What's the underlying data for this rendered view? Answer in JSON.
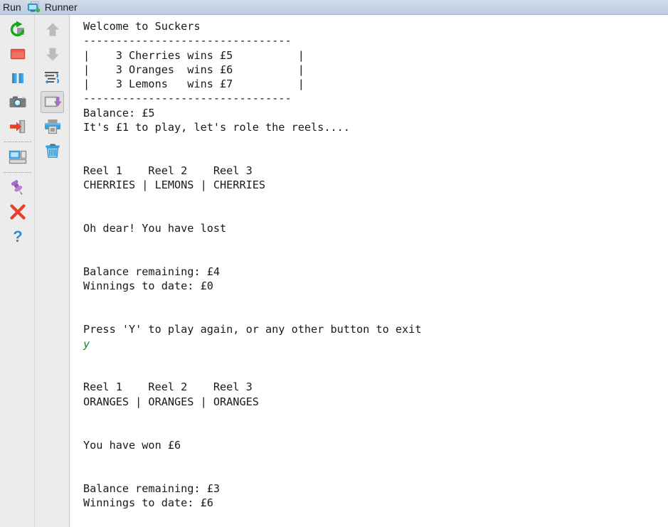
{
  "window": {
    "run_label": "Run",
    "tab": {
      "label": "Runner",
      "icon": "console-window-running-icon",
      "status_color": "#39b54a"
    },
    "titlebar_color": "#c5d2e4"
  },
  "toolbar": {
    "column_one": [
      {
        "name": "rerun-button",
        "icon": "rerun-icon",
        "tooltip": "Rerun",
        "color": "#17a81a",
        "enabled": true
      },
      {
        "name": "stop-button",
        "icon": "stop-square-icon",
        "tooltip": "Stop",
        "color": "#ef5a4c",
        "enabled": true
      },
      {
        "name": "pause-button",
        "icon": "pause-bars-icon",
        "tooltip": "Pause Output",
        "color": "#2e8fd0",
        "enabled": true
      },
      {
        "name": "dump-threads-button",
        "icon": "camera-icon",
        "tooltip": "Dump Threads",
        "color": "#6d6d6d",
        "enabled": true
      },
      {
        "name": "resume-button",
        "icon": "arrow-into-door-icon",
        "tooltip": "Resume Program",
        "color": "#e8402a",
        "enabled": true
      },
      {
        "name": "layout-button",
        "icon": "console-layout-icon",
        "tooltip": "Layout Settings",
        "color": "#2e8fd0",
        "enabled": true
      },
      {
        "name": "pin-tab-button",
        "icon": "pin-icon",
        "tooltip": "Pin Tab",
        "color": "#9b59b6",
        "enabled": true
      },
      {
        "name": "close-button",
        "icon": "close-x-icon",
        "tooltip": "Close",
        "color": "#e8402a",
        "enabled": true
      },
      {
        "name": "help-button",
        "icon": "question-mark-icon",
        "tooltip": "Help",
        "color": "#2e8fd0",
        "enabled": true
      }
    ],
    "column_two": [
      {
        "name": "up-button",
        "icon": "arrow-up-icon",
        "tooltip": "Up",
        "color": "#bcbcbc",
        "enabled": false
      },
      {
        "name": "down-button",
        "icon": "arrow-down-icon",
        "tooltip": "Down",
        "color": "#bcbcbc",
        "enabled": false
      },
      {
        "name": "soft-wrap-button",
        "icon": "soft-wrap-icon",
        "tooltip": "Use Soft Wraps",
        "color": "#2e8fd0",
        "enabled": true
      },
      {
        "name": "scroll-to-end-button",
        "icon": "scroll-to-end-icon",
        "tooltip": "Scroll to the end",
        "color": "#9b59b6",
        "enabled": true,
        "selected": true
      },
      {
        "name": "print-button",
        "icon": "printer-icon",
        "tooltip": "Print",
        "color": "#2e8fd0",
        "enabled": true
      },
      {
        "name": "clear-all-button",
        "icon": "trash-icon",
        "tooltip": "Clear All",
        "color": "#2e8fd0",
        "enabled": true
      }
    ]
  },
  "console": {
    "prompt_input_color": "#12822b",
    "lines": [
      {
        "text": "Welcome to Suckers",
        "kind": "output"
      },
      {
        "text": "--------------------------------",
        "kind": "output"
      },
      {
        "text": "|    3 Cherries wins £5          |",
        "kind": "output"
      },
      {
        "text": "|    3 Oranges  wins £6          |",
        "kind": "output"
      },
      {
        "text": "|    3 Lemons   wins £7          |",
        "kind": "output"
      },
      {
        "text": "--------------------------------",
        "kind": "output"
      },
      {
        "text": "Balance: £5",
        "kind": "output"
      },
      {
        "text": "It's £1 to play, let's role the reels....",
        "kind": "output"
      },
      {
        "text": "",
        "kind": "output"
      },
      {
        "text": "",
        "kind": "output"
      },
      {
        "text": "Reel 1    Reel 2    Reel 3",
        "kind": "output"
      },
      {
        "text": "CHERRIES | LEMONS | CHERRIES",
        "kind": "output"
      },
      {
        "text": "",
        "kind": "output"
      },
      {
        "text": "",
        "kind": "output"
      },
      {
        "text": "Oh dear! You have lost",
        "kind": "output"
      },
      {
        "text": "",
        "kind": "output"
      },
      {
        "text": "",
        "kind": "output"
      },
      {
        "text": "Balance remaining: £4",
        "kind": "output"
      },
      {
        "text": "Winnings to date: £0",
        "kind": "output"
      },
      {
        "text": "",
        "kind": "output"
      },
      {
        "text": "",
        "kind": "output"
      },
      {
        "text": "Press 'Y' to play again, or any other button to exit",
        "kind": "output"
      },
      {
        "text": "y",
        "kind": "input"
      },
      {
        "text": "",
        "kind": "output"
      },
      {
        "text": "",
        "kind": "output"
      },
      {
        "text": "Reel 1    Reel 2    Reel 3",
        "kind": "output"
      },
      {
        "text": "ORANGES | ORANGES | ORANGES",
        "kind": "output"
      },
      {
        "text": "",
        "kind": "output"
      },
      {
        "text": "",
        "kind": "output"
      },
      {
        "text": "You have won £6",
        "kind": "output"
      },
      {
        "text": "",
        "kind": "output"
      },
      {
        "text": "",
        "kind": "output"
      },
      {
        "text": "Balance remaining: £3",
        "kind": "output"
      },
      {
        "text": "Winnings to date: £6",
        "kind": "output"
      }
    ]
  }
}
